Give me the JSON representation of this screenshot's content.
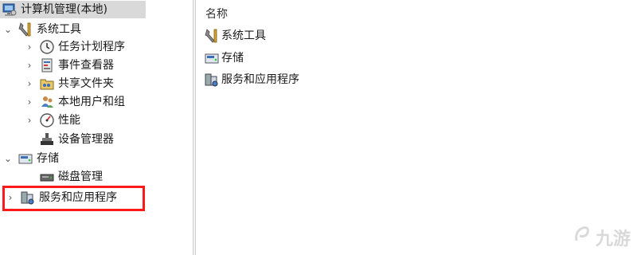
{
  "tree": {
    "root_label": "计算机管理(本地)",
    "system_tools": {
      "label": "系统工具",
      "children": [
        {
          "label": "任务计划程序",
          "icon": "clock-icon"
        },
        {
          "label": "事件查看器",
          "icon": "event-viewer-icon"
        },
        {
          "label": "共享文件夹",
          "icon": "shared-folder-icon"
        },
        {
          "label": "本地用户和组",
          "icon": "users-icon"
        },
        {
          "label": "性能",
          "icon": "performance-icon"
        },
        {
          "label": "设备管理器",
          "icon": "device-manager-icon"
        }
      ]
    },
    "storage": {
      "label": "存储",
      "children": [
        {
          "label": "磁盘管理",
          "icon": "disk-icon"
        }
      ]
    },
    "services": {
      "label": "服务和应用程序"
    }
  },
  "list": {
    "column_name": "名称",
    "items": [
      {
        "label": "系统工具",
        "icon": "tools-icon"
      },
      {
        "label": "存储",
        "icon": "storage-icon"
      },
      {
        "label": "服务和应用程序",
        "icon": "services-icon"
      }
    ]
  },
  "highlight_color": "#ff1a1a",
  "watermark": "九游"
}
